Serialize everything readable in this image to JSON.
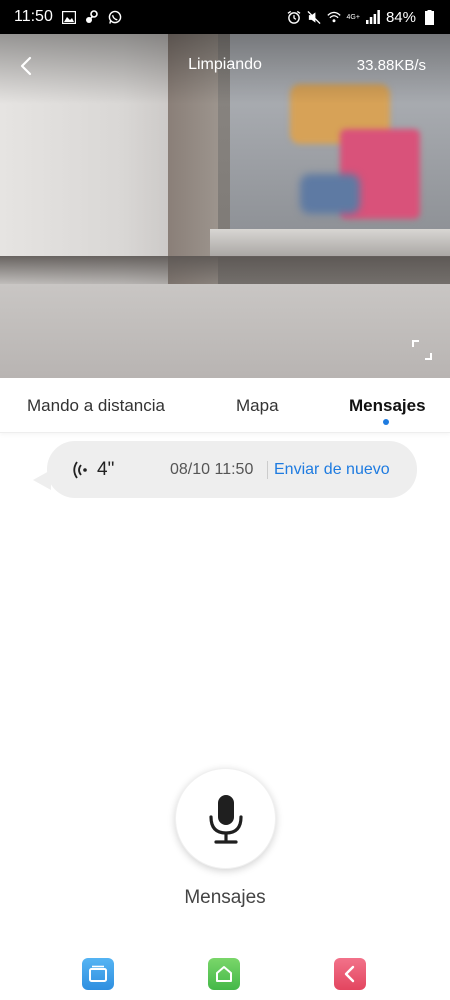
{
  "status_bar": {
    "time": "11:50",
    "network_label": "4G+",
    "battery": "84%"
  },
  "camera": {
    "title": "Limpiando",
    "speed": "33.88KB/s"
  },
  "tabs": [
    {
      "label": "Mando a distancia",
      "active": false
    },
    {
      "label": "Mapa",
      "active": false
    },
    {
      "label": "Mensajes",
      "active": true
    }
  ],
  "message": {
    "duration": "4\"",
    "date": "08/10 11:50",
    "resend_label": "Enviar de nuevo"
  },
  "record": {
    "label": "Mensajes"
  },
  "colors": {
    "accent": "#1e7be0",
    "bubble": "#eeeeee"
  },
  "icons": {
    "status_left": [
      "image-icon",
      "steam-icon",
      "whatsapp-icon"
    ],
    "status_right": [
      "alarm-icon",
      "mute-icon",
      "wifi-icon",
      "signal-icon",
      "battery-icon"
    ],
    "nav": [
      "recent-apps-icon",
      "home-icon",
      "back-icon"
    ]
  }
}
